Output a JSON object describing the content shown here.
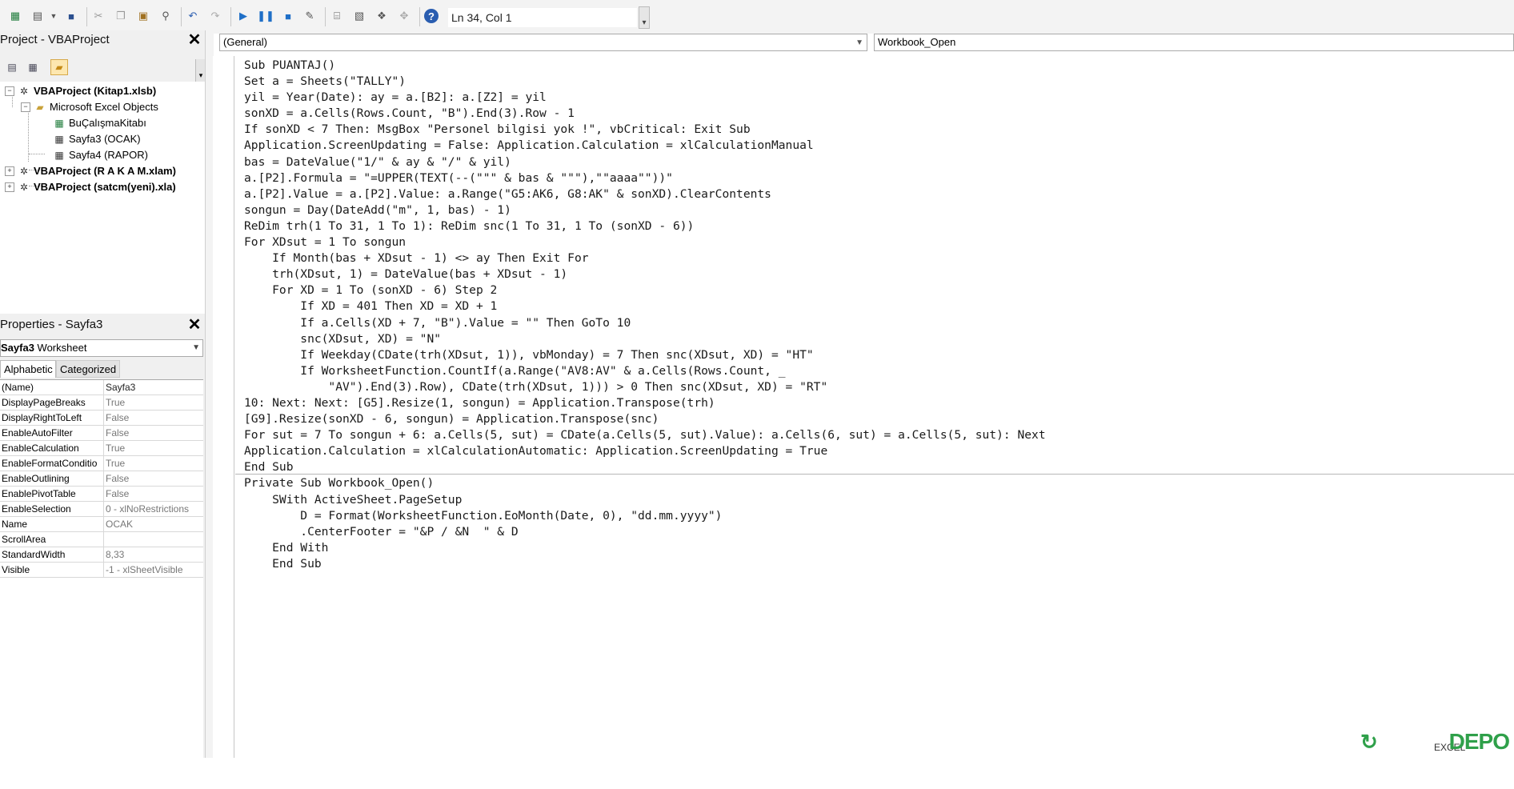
{
  "toolbar": {
    "status": "Ln 34, Col 1",
    "icons": [
      "excel-icon",
      "insert-userform-icon",
      "dropdown-icon",
      "save-icon",
      "cut-icon",
      "copy-icon",
      "paste-icon",
      "find-icon",
      "undo-icon",
      "redo-icon",
      "run-icon",
      "break-icon",
      "reset-icon",
      "design-mode-icon",
      "project-explorer-icon",
      "properties-icon",
      "object-browser-icon",
      "toolbox-icon",
      "help-icon"
    ]
  },
  "project": {
    "title": "Project - VBAProject",
    "tree": [
      {
        "label": "VBAProject (Kitap1.xlsb)",
        "bold": true,
        "expander": "⊟"
      },
      {
        "label": "Microsoft Excel Objects",
        "bold": false,
        "expander": "⊟"
      },
      {
        "label": "BuÇalışmaKitabı",
        "bold": false,
        "expander": ""
      },
      {
        "label": "Sayfa3 (OCAK)",
        "bold": false,
        "expander": ""
      },
      {
        "label": "Sayfa4 (RAPOR)",
        "bold": false,
        "expander": ""
      },
      {
        "label": "VBAProject (R A K A M.xlam)",
        "bold": true,
        "expander": "⊞"
      },
      {
        "label": "VBAProject (satcm(yeni).xla)",
        "bold": true,
        "expander": "⊞"
      }
    ]
  },
  "properties": {
    "title": "Properties - Sayfa3",
    "object_name": "Sayfa3",
    "object_type": "Worksheet",
    "tabs": [
      "Alphabetic",
      "Categorized"
    ],
    "rows": [
      {
        "name": "(Name)",
        "value": "Sayfa3"
      },
      {
        "name": "DisplayPageBreaks",
        "value": "True"
      },
      {
        "name": "DisplayRightToLeft",
        "value": "False"
      },
      {
        "name": "EnableAutoFilter",
        "value": "False"
      },
      {
        "name": "EnableCalculation",
        "value": "True"
      },
      {
        "name": "EnableFormatConditio",
        "value": "True"
      },
      {
        "name": "EnableOutlining",
        "value": "False"
      },
      {
        "name": "EnablePivotTable",
        "value": "False"
      },
      {
        "name": "EnableSelection",
        "value": "0 - xlNoRestrictions"
      },
      {
        "name": "Name",
        "value": "OCAK"
      },
      {
        "name": "ScrollArea",
        "value": ""
      },
      {
        "name": "StandardWidth",
        "value": "8,33"
      },
      {
        "name": "Visible",
        "value": "-1 - xlSheetVisible"
      }
    ]
  },
  "editor": {
    "object_combo": "(General)",
    "proc_combo": "Workbook_Open",
    "code_lines": [
      "Sub PUANTAJ()",
      "Set a = Sheets(\"TALLY\")",
      "yil = Year(Date): ay = a.[B2]: a.[Z2] = yil",
      "sonXD = a.Cells(Rows.Count, \"B\").End(3).Row - 1",
      "If sonXD < 7 Then: MsgBox \"Personel bilgisi yok !\", vbCritical: Exit Sub",
      "Application.ScreenUpdating = False: Application.Calculation = xlCalculationManual",
      "bas = DateValue(\"1/\" & ay & \"/\" & yil)",
      "a.[P2].Formula = \"=UPPER(TEXT(--(\"\"\" & bas & \"\"\"),\"\"aaaa\"\"))\"",
      "a.[P2].Value = a.[P2].Value: a.Range(\"G5:AK6, G8:AK\" & sonXD).ClearContents",
      "songun = Day(DateAdd(\"m\", 1, bas) - 1)",
      "ReDim trh(1 To 31, 1 To 1): ReDim snc(1 To 31, 1 To (sonXD - 6))",
      "For XDsut = 1 To songun",
      "    If Month(bas + XDsut - 1) <> ay Then Exit For",
      "    trh(XDsut, 1) = DateValue(bas + XDsut - 1)",
      "    For XD = 1 To (sonXD - 6) Step 2",
      "        If XD = 401 Then XD = XD + 1",
      "        If a.Cells(XD + 7, \"B\").Value = \"\" Then GoTo 10",
      "        snc(XDsut, XD) = \"N\"",
      "        If Weekday(CDate(trh(XDsut, 1)), vbMonday) = 7 Then snc(XDsut, XD) = \"HT\"",
      "        If WorksheetFunction.CountIf(a.Range(\"AV8:AV\" & a.Cells(Rows.Count, _",
      "            \"AV\").End(3).Row), CDate(trh(XDsut, 1))) > 0 Then snc(XDsut, XD) = \"RT\"",
      "10: Next: Next: [G5].Resize(1, songun) = Application.Transpose(trh)",
      "[G9].Resize(sonXD - 6, songun) = Application.Transpose(snc)",
      "For sut = 7 To songun + 6: a.Cells(5, sut) = CDate(a.Cells(5, sut).Value): a.Cells(6, sut) = a.Cells(5, sut): Next",
      "Application.Calculation = xlCalculationAutomatic: Application.ScreenUpdating = True",
      "End Sub",
      "Private Sub Workbook_Open()",
      "    SWith ActiveSheet.PageSetup",
      "        D = Format(WorksheetFunction.EoMonth(Date, 0), \"dd.mm.yyyy\")",
      "        .CenterFooter = \"&P / &N  \" & D",
      "    End With",
      "    End Sub"
    ]
  },
  "branding": {
    "logo_text": "DEPO",
    "logo_small": "EXCEL",
    "color": "#2fa04a"
  }
}
